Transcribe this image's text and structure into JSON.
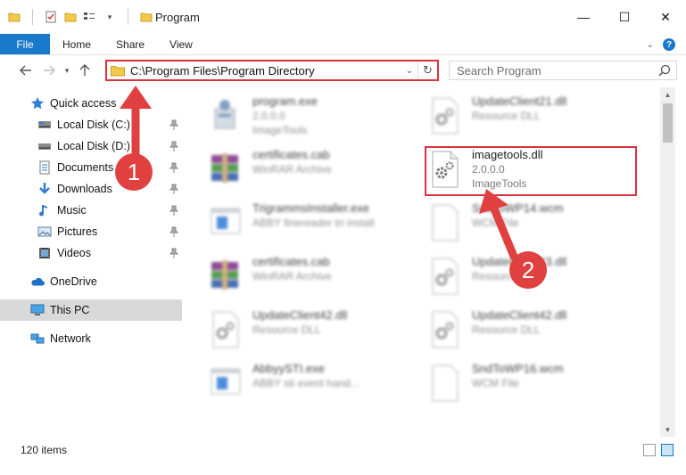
{
  "window": {
    "title": "Program",
    "controls": {
      "minimize": "—",
      "maximize": "☐",
      "close": "✕"
    }
  },
  "ribbon": {
    "tabs": [
      {
        "label": "File"
      },
      {
        "label": "Home"
      },
      {
        "label": "Share"
      },
      {
        "label": "View"
      }
    ],
    "help": "?"
  },
  "address": {
    "path": "C:\\Program Files\\Program Directory",
    "search_placeholder": "Search Program"
  },
  "nav": {
    "items": [
      {
        "label": "Quick access",
        "icon": "star-icon",
        "pinned": false
      },
      {
        "label": "Local Disk (C:)",
        "icon": "drive-icon",
        "pinned": true
      },
      {
        "label": "Local Disk (D:)",
        "icon": "drive-icon",
        "pinned": true
      },
      {
        "label": "Documents",
        "icon": "documents-icon",
        "pinned": true
      },
      {
        "label": "Downloads",
        "icon": "downloads-icon",
        "pinned": true
      },
      {
        "label": "Music",
        "icon": "music-icon",
        "pinned": true
      },
      {
        "label": "Pictures",
        "icon": "pictures-icon",
        "pinned": true
      },
      {
        "label": "Videos",
        "icon": "videos-icon",
        "pinned": true
      },
      {
        "label": "OneDrive",
        "icon": "onedrive-icon",
        "pinned": false
      },
      {
        "label": "This PC",
        "icon": "computer-icon",
        "pinned": false,
        "selected": true
      },
      {
        "label": "Network",
        "icon": "network-icon",
        "pinned": false
      }
    ]
  },
  "files": {
    "left": [
      {
        "name": "program.exe",
        "line2": "2.0.0.0",
        "line3": "ImageTools",
        "icon": "installer-icon"
      },
      {
        "name": "certificates.cab",
        "line2": "WinRAR Archive",
        "line3": "",
        "icon": "winrar-icon"
      },
      {
        "name": "TrigrammsInstaller.exe",
        "line2": "ABBY finereader tri install",
        "line3": "",
        "icon": "app-icon"
      },
      {
        "name": "certificates.cab",
        "line2": "WinRAR Archive",
        "line3": "",
        "icon": "winrar-icon"
      },
      {
        "name": "UpdateClient42.dll",
        "line2": "Resource DLL",
        "line3": "",
        "icon": "dll-icon"
      },
      {
        "name": "AbbyySTI.exe",
        "line2": "ABBY sti event hand...",
        "line3": "",
        "icon": "app-icon"
      }
    ],
    "right": [
      {
        "name": "UpdateClient21.dll",
        "line2": "Resource DLL",
        "line3": "",
        "icon": "dll-icon"
      },
      {
        "name": "imagetools.dll",
        "line2": "2.0.0.0",
        "line3": "ImageTools",
        "icon": "dll-icon",
        "highlighted": true
      },
      {
        "name": "SndToWP14.wcm",
        "line2": "WCM File",
        "line3": "",
        "icon": "file-icon"
      },
      {
        "name": "UpdateClient43.dll",
        "line2": "Resource DLL",
        "line3": "",
        "icon": "dll-icon"
      },
      {
        "name": "UpdateClient42.dll",
        "line2": "Resource DLL",
        "line3": "",
        "icon": "dll-icon"
      },
      {
        "name": "SndToWP16.wcm",
        "line2": "WCM File",
        "line3": "",
        "icon": "file-icon"
      }
    ]
  },
  "status": {
    "item_count": "120 items"
  },
  "annotations": {
    "step1": "1",
    "step2": "2"
  },
  "colors": {
    "accent": "#1979ca",
    "annotation": "#d9333f"
  }
}
